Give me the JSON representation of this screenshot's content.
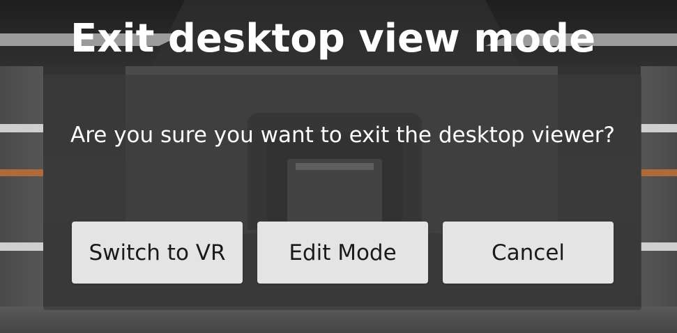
{
  "dialog": {
    "title": "Exit desktop view mode",
    "message": "Are you sure you want to exit the desktop viewer?",
    "buttons": {
      "switch_vr": "Switch to VR",
      "edit_mode": "Edit Mode",
      "cancel": "Cancel"
    }
  },
  "colors": {
    "button_bg": "#e4e4e4",
    "button_text": "#1a1a1a",
    "title_text": "#ffffff",
    "overlay": "rgba(58,58,58,0.72)"
  }
}
